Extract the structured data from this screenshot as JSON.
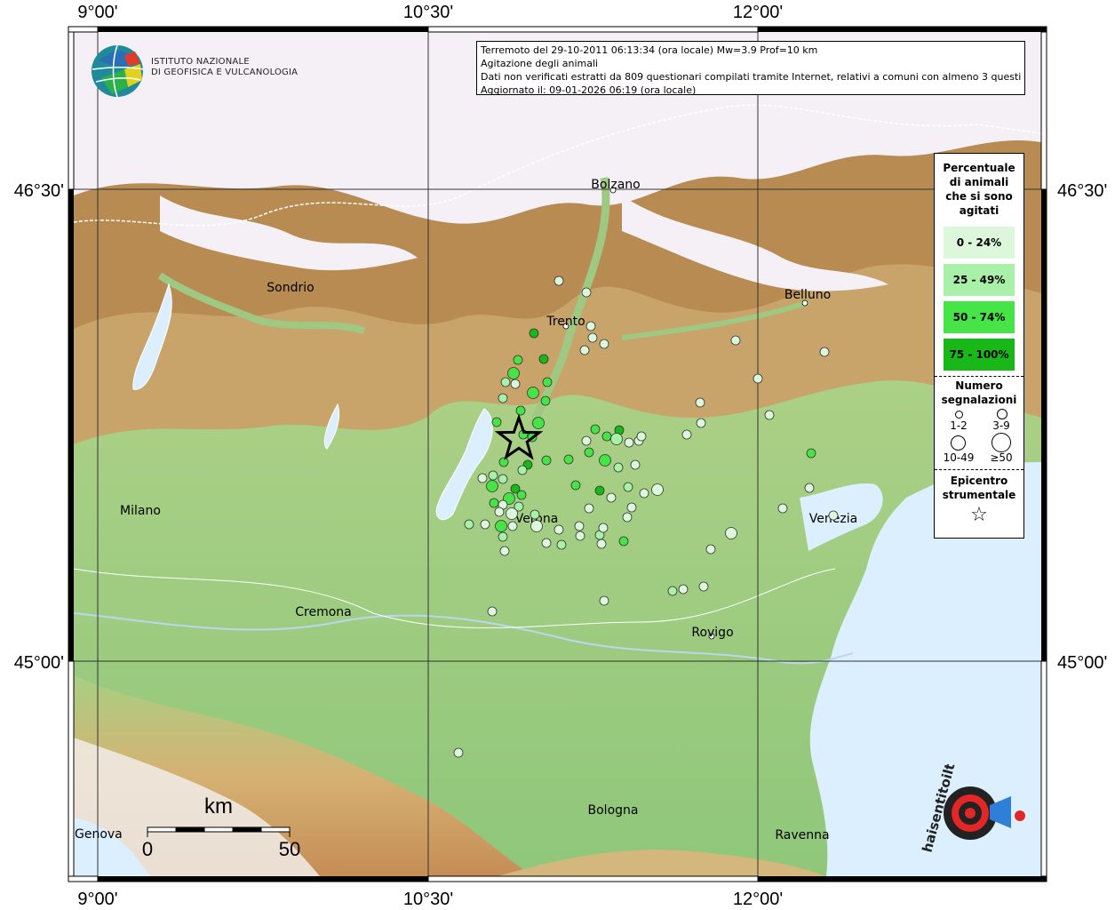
{
  "info": {
    "line1": "Terremoto del 29-10-2011 06:13:34 (ora locale) Mw=3.9 Prof=10 km",
    "line2": "Agitazione degli animali",
    "line3": "Dati non verificati estratti da 809 questionari compilati tramite Internet, relativi a comuni con almeno 3 questionari.",
    "line4": "Aggiornato il: 09-01-2026 06:19 (ora locale)"
  },
  "ingv": {
    "line1": "ISTITUTO NAZIONALE",
    "line2": "DI GEOFISICA E VULCANOLOGIA"
  },
  "frame": {
    "lon_labels": [
      "9°00'",
      "10°30'",
      "12°00'"
    ],
    "lat_labels": [
      "46°30'",
      "45°00'"
    ]
  },
  "cities": [
    {
      "name": "Bolzano"
    },
    {
      "name": "Sondrio"
    },
    {
      "name": "Trento"
    },
    {
      "name": "Belluno"
    },
    {
      "name": "Milano"
    },
    {
      "name": "Verona"
    },
    {
      "name": "Venezia"
    },
    {
      "name": "Cremona"
    },
    {
      "name": "Rovigo"
    },
    {
      "name": "Bologna"
    },
    {
      "name": "Ravenna"
    },
    {
      "name": "Genova"
    }
  ],
  "scalebar": {
    "unit": "km",
    "start": "0",
    "end": "50"
  },
  "legend": {
    "title": [
      "Percentuale",
      "di animali",
      "che si sono",
      "agitati"
    ],
    "classes": [
      {
        "label": "0 - 24%",
        "color": "#ddf7dd"
      },
      {
        "label": "25 - 49%",
        "color": "#a9f0a9"
      },
      {
        "label": "50 - 74%",
        "color": "#46e446"
      },
      {
        "label": "75 - 100%",
        "color": "#18b818"
      }
    ],
    "count_title": [
      "Numero",
      "segnalazioni"
    ],
    "count_classes": [
      "1-2",
      "3-9",
      "10-49",
      "≥50"
    ],
    "epicentre_title": [
      "Epicentro",
      "strumentale"
    ]
  },
  "colors": {
    "sea": "#dcefff",
    "plain": "#a8d18a",
    "hill": "#c9a66a",
    "mountain": "#f4f0f6",
    "epicentre_star": "#000000"
  },
  "hst_logo": {
    "text": "haisentitoilterremoto.it"
  }
}
